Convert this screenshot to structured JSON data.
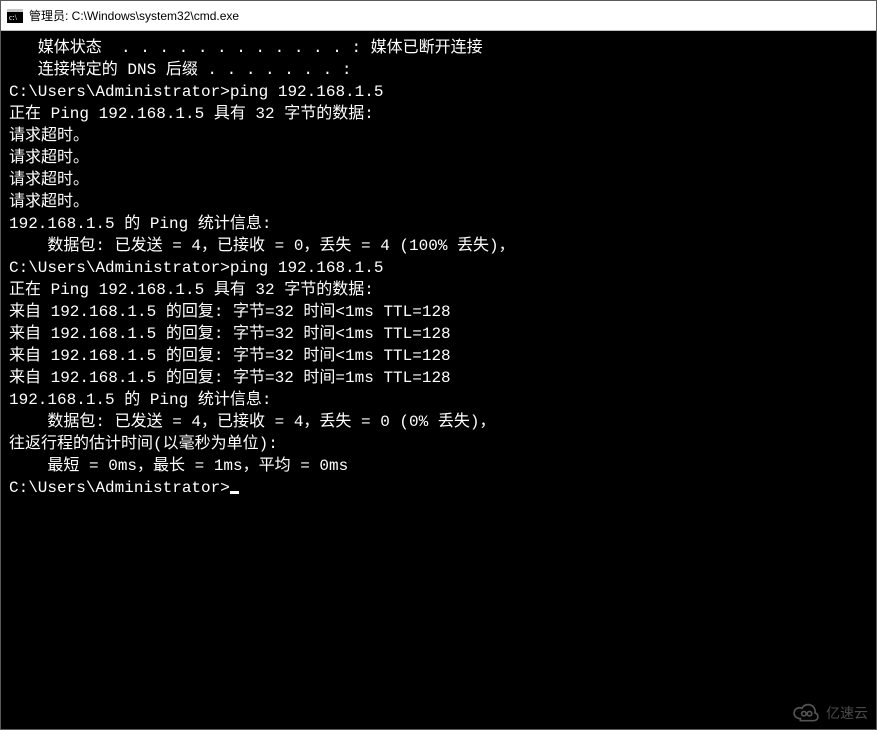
{
  "window": {
    "title": "管理员: C:\\Windows\\system32\\cmd.exe",
    "icon_name": "cmd-icon"
  },
  "watermark": {
    "text": "亿速云"
  },
  "terminal": {
    "prompt": "C:\\Users\\Administrator>",
    "lines": [
      "",
      "   媒体状态  . . . . . . . . . . . . : 媒体已断开连接",
      "   连接特定的 DNS 后缀 . . . . . . . :",
      "",
      "C:\\Users\\Administrator>ping 192.168.1.5",
      "",
      "正在 Ping 192.168.1.5 具有 32 字节的数据:",
      "请求超时。",
      "请求超时。",
      "请求超时。",
      "请求超时。",
      "",
      "192.168.1.5 的 Ping 统计信息:",
      "    数据包: 已发送 = 4，已接收 = 0，丢失 = 4 (100% 丢失)，",
      "",
      "C:\\Users\\Administrator>ping 192.168.1.5",
      "",
      "正在 Ping 192.168.1.5 具有 32 字节的数据:",
      "来自 192.168.1.5 的回复: 字节=32 时间<1ms TTL=128",
      "来自 192.168.1.5 的回复: 字节=32 时间<1ms TTL=128",
      "来自 192.168.1.5 的回复: 字节=32 时间<1ms TTL=128",
      "来自 192.168.1.5 的回复: 字节=32 时间=1ms TTL=128",
      "",
      "192.168.1.5 的 Ping 统计信息:",
      "    数据包: 已发送 = 4，已接收 = 4，丢失 = 0 (0% 丢失)，",
      "往返行程的估计时间(以毫秒为单位):",
      "    最短 = 0ms，最长 = 1ms，平均 = 0ms",
      "",
      "C:\\Users\\Administrator>"
    ],
    "cursor_on_last": true
  }
}
